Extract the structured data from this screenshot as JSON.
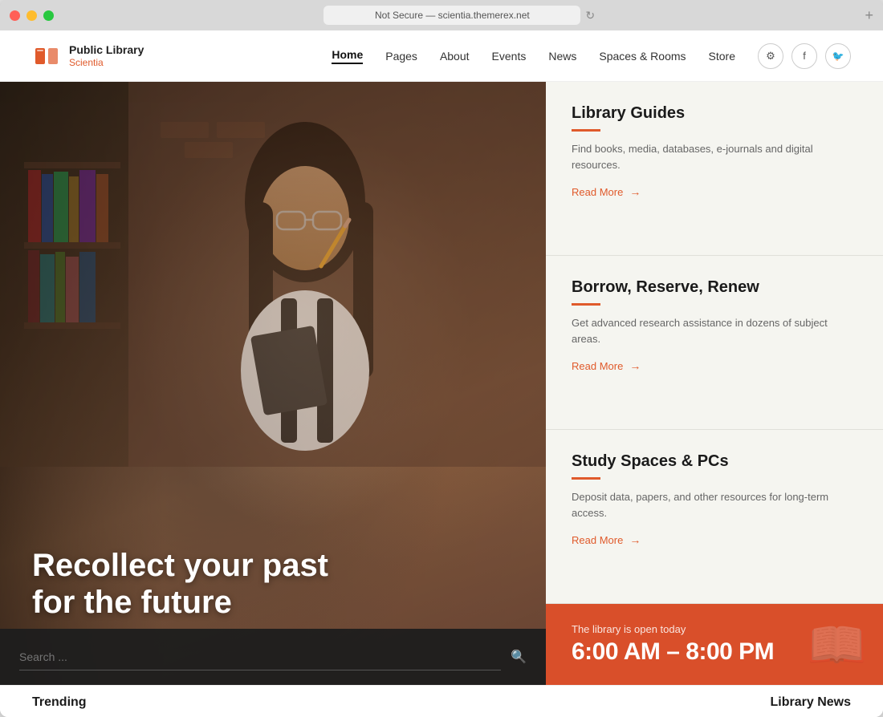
{
  "browser": {
    "address": "Not Secure — scientia.themerex.net",
    "new_tab_label": "+"
  },
  "header": {
    "logo_name": "Public Library",
    "logo_subtitle": "Scientia",
    "nav": [
      {
        "label": "Home",
        "active": true
      },
      {
        "label": "Pages",
        "active": false
      },
      {
        "label": "About",
        "active": false
      },
      {
        "label": "Events",
        "active": false
      },
      {
        "label": "News",
        "active": false
      },
      {
        "label": "Spaces & Rooms",
        "active": false
      },
      {
        "label": "Store",
        "active": false
      }
    ]
  },
  "hero": {
    "headline": "Recollect your past\nfor the future",
    "search_placeholder": "Search ..."
  },
  "guides": [
    {
      "title": "Library Guides",
      "description": "Find books, media, databases, e-journals and digital resources.",
      "read_more": "Read More"
    },
    {
      "title": "Borrow, Reserve, Renew",
      "description": "Get advanced research assistance in dozens of subject areas.",
      "read_more": "Read More"
    },
    {
      "title": "Study Spaces & PCs",
      "description": "Deposit data, papers, and other resources for long-term access.",
      "read_more": "Read More"
    }
  ],
  "hours": {
    "label": "The library is open today",
    "time": "6:00 AM – 8:00 PM"
  },
  "bottom": {
    "left_title": "Trending",
    "right_title": "Library News"
  }
}
